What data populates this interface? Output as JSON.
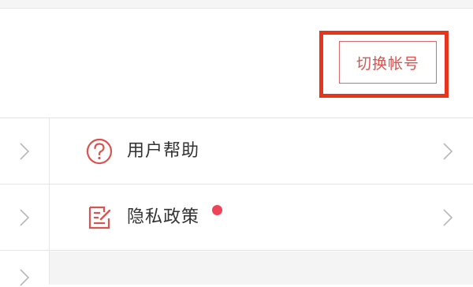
{
  "header": {
    "switch_account_label": "切换帐号"
  },
  "menu": {
    "items": [
      {
        "label": "用户帮助",
        "icon": "help-circle-icon",
        "has_badge": false
      },
      {
        "label": "隐私政策",
        "icon": "edit-document-icon",
        "has_badge": true
      }
    ]
  },
  "colors": {
    "accent": "#d9534f",
    "highlight": "#e8341c",
    "badge": "#f0435a"
  }
}
